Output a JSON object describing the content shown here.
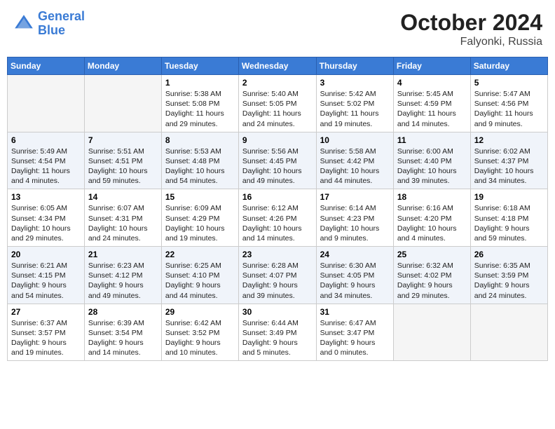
{
  "header": {
    "logo_line1": "General",
    "logo_line2": "Blue",
    "month": "October 2024",
    "location": "Falyonki, Russia"
  },
  "weekdays": [
    "Sunday",
    "Monday",
    "Tuesday",
    "Wednesday",
    "Thursday",
    "Friday",
    "Saturday"
  ],
  "weeks": [
    [
      {
        "day": "",
        "empty": true
      },
      {
        "day": "",
        "empty": true
      },
      {
        "day": "1",
        "line1": "Sunrise: 5:38 AM",
        "line2": "Sunset: 5:08 PM",
        "line3": "Daylight: 11 hours",
        "line4": "and 29 minutes."
      },
      {
        "day": "2",
        "line1": "Sunrise: 5:40 AM",
        "line2": "Sunset: 5:05 PM",
        "line3": "Daylight: 11 hours",
        "line4": "and 24 minutes."
      },
      {
        "day": "3",
        "line1": "Sunrise: 5:42 AM",
        "line2": "Sunset: 5:02 PM",
        "line3": "Daylight: 11 hours",
        "line4": "and 19 minutes."
      },
      {
        "day": "4",
        "line1": "Sunrise: 5:45 AM",
        "line2": "Sunset: 4:59 PM",
        "line3": "Daylight: 11 hours",
        "line4": "and 14 minutes."
      },
      {
        "day": "5",
        "line1": "Sunrise: 5:47 AM",
        "line2": "Sunset: 4:56 PM",
        "line3": "Daylight: 11 hours",
        "line4": "and 9 minutes."
      }
    ],
    [
      {
        "day": "6",
        "line1": "Sunrise: 5:49 AM",
        "line2": "Sunset: 4:54 PM",
        "line3": "Daylight: 11 hours",
        "line4": "and 4 minutes."
      },
      {
        "day": "7",
        "line1": "Sunrise: 5:51 AM",
        "line2": "Sunset: 4:51 PM",
        "line3": "Daylight: 10 hours",
        "line4": "and 59 minutes."
      },
      {
        "day": "8",
        "line1": "Sunrise: 5:53 AM",
        "line2": "Sunset: 4:48 PM",
        "line3": "Daylight: 10 hours",
        "line4": "and 54 minutes."
      },
      {
        "day": "9",
        "line1": "Sunrise: 5:56 AM",
        "line2": "Sunset: 4:45 PM",
        "line3": "Daylight: 10 hours",
        "line4": "and 49 minutes."
      },
      {
        "day": "10",
        "line1": "Sunrise: 5:58 AM",
        "line2": "Sunset: 4:42 PM",
        "line3": "Daylight: 10 hours",
        "line4": "and 44 minutes."
      },
      {
        "day": "11",
        "line1": "Sunrise: 6:00 AM",
        "line2": "Sunset: 4:40 PM",
        "line3": "Daylight: 10 hours",
        "line4": "and 39 minutes."
      },
      {
        "day": "12",
        "line1": "Sunrise: 6:02 AM",
        "line2": "Sunset: 4:37 PM",
        "line3": "Daylight: 10 hours",
        "line4": "and 34 minutes."
      }
    ],
    [
      {
        "day": "13",
        "line1": "Sunrise: 6:05 AM",
        "line2": "Sunset: 4:34 PM",
        "line3": "Daylight: 10 hours",
        "line4": "and 29 minutes."
      },
      {
        "day": "14",
        "line1": "Sunrise: 6:07 AM",
        "line2": "Sunset: 4:31 PM",
        "line3": "Daylight: 10 hours",
        "line4": "and 24 minutes."
      },
      {
        "day": "15",
        "line1": "Sunrise: 6:09 AM",
        "line2": "Sunset: 4:29 PM",
        "line3": "Daylight: 10 hours",
        "line4": "and 19 minutes."
      },
      {
        "day": "16",
        "line1": "Sunrise: 6:12 AM",
        "line2": "Sunset: 4:26 PM",
        "line3": "Daylight: 10 hours",
        "line4": "and 14 minutes."
      },
      {
        "day": "17",
        "line1": "Sunrise: 6:14 AM",
        "line2": "Sunset: 4:23 PM",
        "line3": "Daylight: 10 hours",
        "line4": "and 9 minutes."
      },
      {
        "day": "18",
        "line1": "Sunrise: 6:16 AM",
        "line2": "Sunset: 4:20 PM",
        "line3": "Daylight: 10 hours",
        "line4": "and 4 minutes."
      },
      {
        "day": "19",
        "line1": "Sunrise: 6:18 AM",
        "line2": "Sunset: 4:18 PM",
        "line3": "Daylight: 9 hours",
        "line4": "and 59 minutes."
      }
    ],
    [
      {
        "day": "20",
        "line1": "Sunrise: 6:21 AM",
        "line2": "Sunset: 4:15 PM",
        "line3": "Daylight: 9 hours",
        "line4": "and 54 minutes."
      },
      {
        "day": "21",
        "line1": "Sunrise: 6:23 AM",
        "line2": "Sunset: 4:12 PM",
        "line3": "Daylight: 9 hours",
        "line4": "and 49 minutes."
      },
      {
        "day": "22",
        "line1": "Sunrise: 6:25 AM",
        "line2": "Sunset: 4:10 PM",
        "line3": "Daylight: 9 hours",
        "line4": "and 44 minutes."
      },
      {
        "day": "23",
        "line1": "Sunrise: 6:28 AM",
        "line2": "Sunset: 4:07 PM",
        "line3": "Daylight: 9 hours",
        "line4": "and 39 minutes."
      },
      {
        "day": "24",
        "line1": "Sunrise: 6:30 AM",
        "line2": "Sunset: 4:05 PM",
        "line3": "Daylight: 9 hours",
        "line4": "and 34 minutes."
      },
      {
        "day": "25",
        "line1": "Sunrise: 6:32 AM",
        "line2": "Sunset: 4:02 PM",
        "line3": "Daylight: 9 hours",
        "line4": "and 29 minutes."
      },
      {
        "day": "26",
        "line1": "Sunrise: 6:35 AM",
        "line2": "Sunset: 3:59 PM",
        "line3": "Daylight: 9 hours",
        "line4": "and 24 minutes."
      }
    ],
    [
      {
        "day": "27",
        "line1": "Sunrise: 6:37 AM",
        "line2": "Sunset: 3:57 PM",
        "line3": "Daylight: 9 hours",
        "line4": "and 19 minutes."
      },
      {
        "day": "28",
        "line1": "Sunrise: 6:39 AM",
        "line2": "Sunset: 3:54 PM",
        "line3": "Daylight: 9 hours",
        "line4": "and 14 minutes."
      },
      {
        "day": "29",
        "line1": "Sunrise: 6:42 AM",
        "line2": "Sunset: 3:52 PM",
        "line3": "Daylight: 9 hours",
        "line4": "and 10 minutes."
      },
      {
        "day": "30",
        "line1": "Sunrise: 6:44 AM",
        "line2": "Sunset: 3:49 PM",
        "line3": "Daylight: 9 hours",
        "line4": "and 5 minutes."
      },
      {
        "day": "31",
        "line1": "Sunrise: 6:47 AM",
        "line2": "Sunset: 3:47 PM",
        "line3": "Daylight: 9 hours",
        "line4": "and 0 minutes."
      },
      {
        "day": "",
        "empty": true
      },
      {
        "day": "",
        "empty": true
      }
    ]
  ]
}
